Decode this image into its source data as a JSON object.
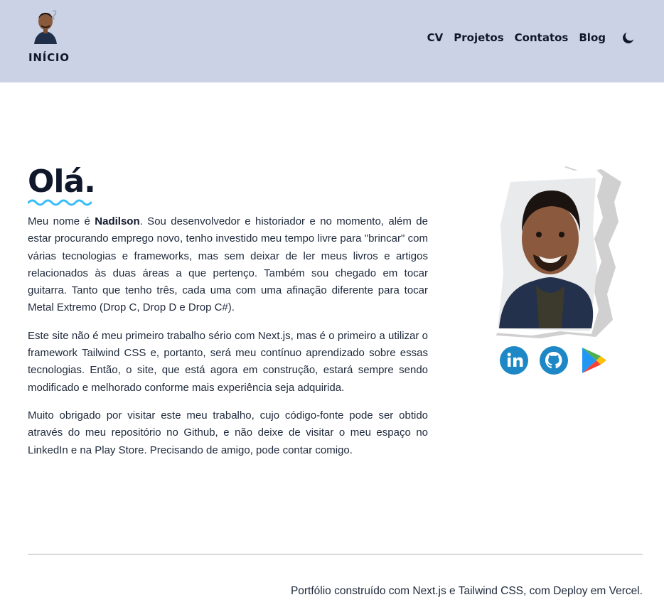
{
  "header": {
    "home_label": "INÍCIO",
    "nav": [
      "CV",
      "Projetos",
      "Contatos",
      "Blog"
    ],
    "theme_icon": "moon-icon",
    "background": "#cbd2e6"
  },
  "main": {
    "greeting": "Olá.",
    "accent_wave_color": "#38bdf8",
    "p1": {
      "before": "Meu nome é ",
      "name": "Nadilson",
      "after": ". Sou desenvolvedor e historiador e no momento, além de estar procurando emprego novo, tenho investido meu tempo livre para \"brincar\" com várias tecnologias e frameworks, mas sem deixar de ler meus livros e artigos relacionados às duas áreas a que pertenço. Também sou chegado em tocar guitarra. Tanto que tenho três, cada uma com uma afinação diferente para tocar Metal Extremo (Drop C, Drop D e Drop C#)."
    },
    "p2": "Este site não é meu primeiro trabalho sério com Next.js, mas é o primeiro a utilizar o framework Tailwind CSS e, portanto, será meu contínuo aprendizado sobre essas tecnologias. Então, o site, que está agora em construção, estará sempre sendo modificado e melhorado conforme mais experiência seja adquirida.",
    "p3": "Muito obrigado por visitar este meu trabalho, cujo código-fonte pode ser obtido através do meu repositório no Github, e não deixe de visitar o meu espaço no LinkedIn e na Play Store. Precisando de amigo, pode contar comigo."
  },
  "social": {
    "icons": [
      "linkedin-icon",
      "github-icon",
      "play-store-icon"
    ],
    "colors": {
      "linkedin": "#1e88c7",
      "github": "#1e88c7"
    }
  },
  "footer": {
    "text": "Portfólio construído com Next.js e Tailwind CSS, com Deploy em Vercel."
  }
}
